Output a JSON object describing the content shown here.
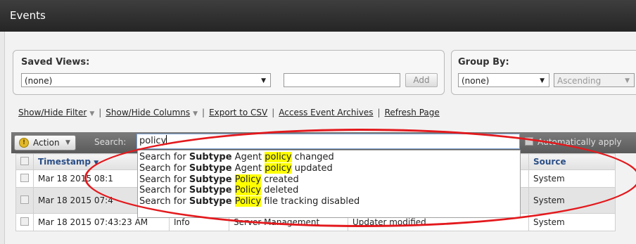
{
  "window": {
    "title": "Events"
  },
  "saved_views": {
    "label": "Saved Views:",
    "selected": "(none)",
    "name_value": "",
    "add_label": "Add"
  },
  "group_by": {
    "label": "Group By:",
    "selected": "(none)",
    "order": "Ascending"
  },
  "links": {
    "show_hide_filter": "Show/Hide Filter",
    "show_hide_columns": "Show/Hide Columns",
    "export_csv": "Export to CSV",
    "access_archives": "Access Event Archives",
    "refresh": "Refresh Page"
  },
  "toolbar": {
    "action_label": "Action",
    "search_label": "Search:",
    "search_value": "policy",
    "auto_apply_label": "Automatically apply"
  },
  "suggestions": [
    {
      "prefix": "Search for ",
      "field": "Subtype",
      "pre": " Agent ",
      "match": "policy",
      "post": " changed"
    },
    {
      "prefix": "Search for ",
      "field": "Subtype",
      "pre": " Agent ",
      "match": "policy",
      "post": " updated"
    },
    {
      "prefix": "Search for ",
      "field": "Subtype",
      "pre": " ",
      "match": "Policy",
      "post": " created"
    },
    {
      "prefix": "Search for ",
      "field": "Subtype",
      "pre": " ",
      "match": "Policy",
      "post": " deleted"
    },
    {
      "prefix": "Search for ",
      "field": "Subtype",
      "pre": " ",
      "match": "Policy",
      "post": " file tracking disabled"
    }
  ],
  "table": {
    "headers": {
      "timestamp": "Timestamp",
      "source": "Source"
    },
    "rows": [
      {
        "timestamp": "Mar 18 2015 08:1",
        "level": "",
        "type": "",
        "subtype": "",
        "source": "System"
      },
      {
        "timestamp": "Mar 18 2015 07:4",
        "level": "",
        "type": "",
        "subtype": "",
        "source": "System"
      },
      {
        "timestamp": "Mar 18 2015 07:43:23 AM",
        "level": "Info",
        "type": "Server Management",
        "subtype": "Updater modified",
        "source": "System"
      }
    ]
  },
  "colors": {
    "annotation": "#e3191d",
    "highlight": "#ffff00",
    "title_bar": "#2f2f2f"
  }
}
